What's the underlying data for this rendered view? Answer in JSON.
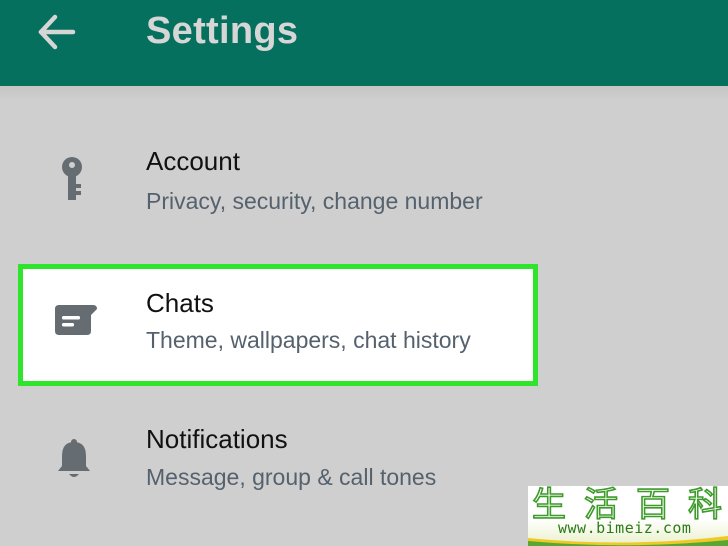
{
  "header": {
    "title": "Settings",
    "back_icon": "arrow-left-icon",
    "background": "#06705f",
    "title_color": "#d6d6d6"
  },
  "settings": {
    "account": {
      "title": "Account",
      "subtitle": "Privacy, security, change number",
      "icon": "key-icon"
    },
    "chats": {
      "title": "Chats",
      "subtitle": "Theme, wallpapers, chat history",
      "icon": "chat-icon",
      "highlight_color": "#2ee52b"
    },
    "notifications": {
      "title": "Notifications",
      "subtitle": "Message, group & call tones",
      "icon": "bell-icon"
    }
  },
  "watermark": {
    "logo_text": "生活百科",
    "url": "www.bimeiz.com"
  }
}
